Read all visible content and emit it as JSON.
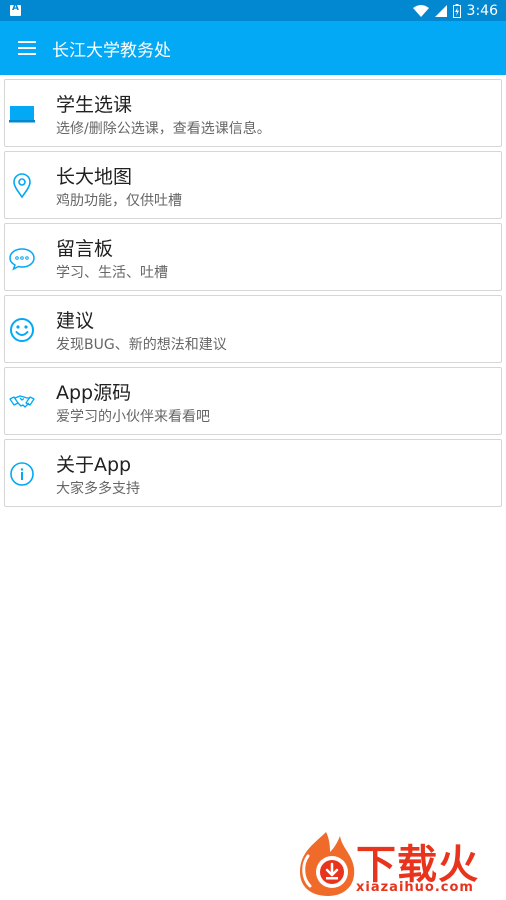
{
  "status_bar": {
    "time": "3:46",
    "icons": [
      "notification-a-icon",
      "wifi-icon",
      "signal-icon",
      "battery-charging-icon"
    ]
  },
  "app_bar": {
    "title": "长江大学教务处",
    "menu_icon": "menu-icon"
  },
  "menu_items": [
    {
      "title": "学生选课",
      "subtitle": "选修/删除公选课，查看选课信息。",
      "icon": "laptop-icon"
    },
    {
      "title": "长大地图",
      "subtitle": "鸡肋功能，仅供吐槽",
      "icon": "location-pin-icon"
    },
    {
      "title": "留言板",
      "subtitle": "学习、生活、吐槽",
      "icon": "chat-bubble-icon"
    },
    {
      "title": "建议",
      "subtitle": "发现BUG、新的想法和建议",
      "icon": "smiley-icon"
    },
    {
      "title": "App源码",
      "subtitle": "爱学习的小伙伴来看看吧",
      "icon": "handshake-icon"
    },
    {
      "title": "关于App",
      "subtitle": "大家多多支持",
      "icon": "info-icon"
    }
  ],
  "watermark": {
    "text": "下载火",
    "domain": "xiazaihuo.com"
  },
  "colors": {
    "status_bar": "#0288d1",
    "app_bar": "#03a9f4",
    "accent": "#03a9f4",
    "watermark": "#e8341c"
  }
}
